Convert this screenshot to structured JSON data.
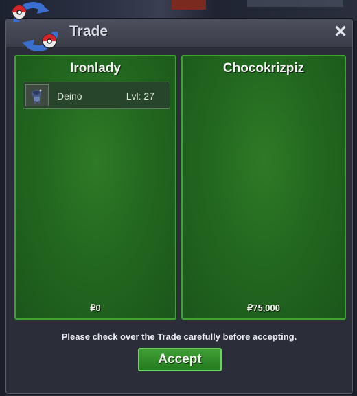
{
  "window": {
    "title": "Trade",
    "close_label": "✕"
  },
  "left_panel": {
    "trainer": "Ironlady",
    "pokemon": [
      {
        "name": "Deino",
        "level": "Lvl: 27"
      }
    ],
    "money": "₽0"
  },
  "right_panel": {
    "trainer": "Chocokrizpiz",
    "pokemon": [],
    "money": "₽75,000"
  },
  "footer": {
    "notice": "Please check over the Trade carefully before accepting.",
    "accept_label": "Accept"
  },
  "colors": {
    "panel_green": "#236820",
    "panel_border": "#3fa334",
    "window_bg": "#2b2d38",
    "accept_green": "#2f8c27"
  },
  "icons": [
    "trade-swap-icon",
    "close-icon",
    "deino-sprite-icon"
  ]
}
